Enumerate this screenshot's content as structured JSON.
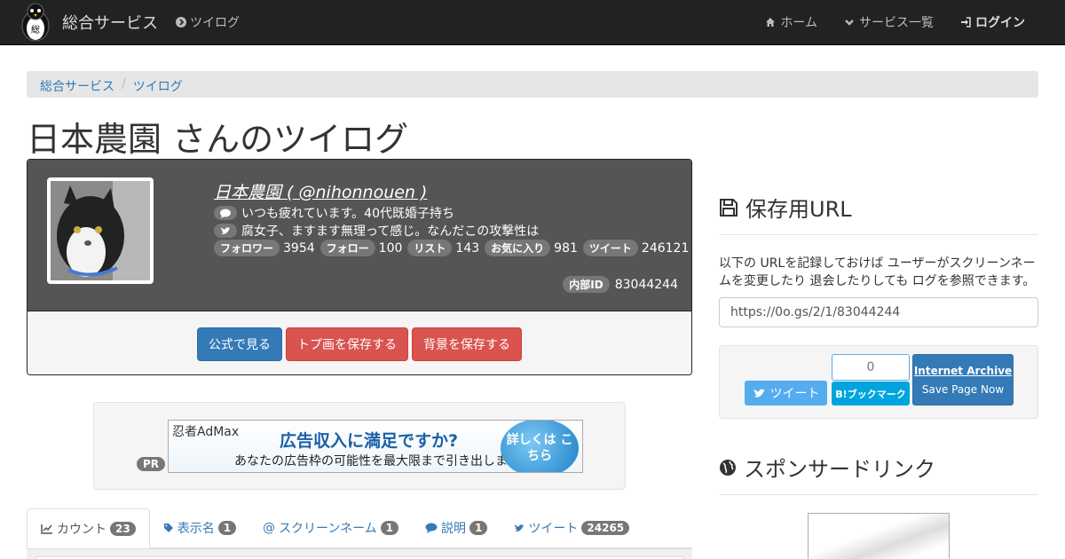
{
  "navbar": {
    "brand": "総合サービス",
    "twilog_link": "ツイログ",
    "home": "ホーム",
    "services": "サービス一覧",
    "login": "ログイン"
  },
  "breadcrumb": [
    "総合サービス",
    "ツイログ"
  ],
  "page_title": "日本農園 さんのツイログ",
  "profile": {
    "name_line": "日本農園 ( @nihonnouen )",
    "bio": "いつも疲れています。40代既婚子持ち",
    "last_tweet": "腐女子、ますます無理って感じ。なんだこの攻撃性は",
    "stats": [
      {
        "label": "フォロワー",
        "value": "3954"
      },
      {
        "label": "フォロー",
        "value": "100"
      },
      {
        "label": "リスト",
        "value": "143"
      },
      {
        "label": "お気に入り",
        "value": "981"
      },
      {
        "label": "ツイート",
        "value": "246121"
      }
    ],
    "internal_id_label": "内部ID",
    "internal_id": "83044244",
    "buttons": {
      "official": "公式で見る",
      "save_header": "トプ画を保存する",
      "save_bg": "背景を保存する"
    }
  },
  "ad": {
    "pr": "PR",
    "brand": "忍者AdMax",
    "headline": "広告収入に満足ですか?",
    "sub": "あなたの広告枠の可能性を最大限まで引き出します",
    "cta": "詳しくは こちら"
  },
  "tabs": [
    {
      "label": "カウント",
      "count": "23"
    },
    {
      "label": "表示名",
      "count": "1"
    },
    {
      "label": "スクリーンネーム",
      "count": "1"
    },
    {
      "label": "説明",
      "count": "1"
    },
    {
      "label": "ツイート",
      "count": "24265"
    }
  ],
  "save_url": {
    "heading": "保存用URL",
    "description": "以下の URLを記録しておけば ユーザーがスクリーンネームを変更したり 退会したりしても ログを参照できます。",
    "url": "https://0o.gs/2/1/83044244"
  },
  "share": {
    "tweet": "ツイート",
    "hatena_count": "0",
    "hatena": "B!ブックマーク",
    "ia_title": "Internet Archive",
    "ia_sub": "Save Page Now"
  },
  "sponsor": {
    "heading": "スポンサードリンク"
  },
  "colors": {
    "navbar": "#222222",
    "primary": "#337ab7",
    "danger": "#d9534f",
    "twitter": "#55acee",
    "hatena": "#00a4de"
  }
}
